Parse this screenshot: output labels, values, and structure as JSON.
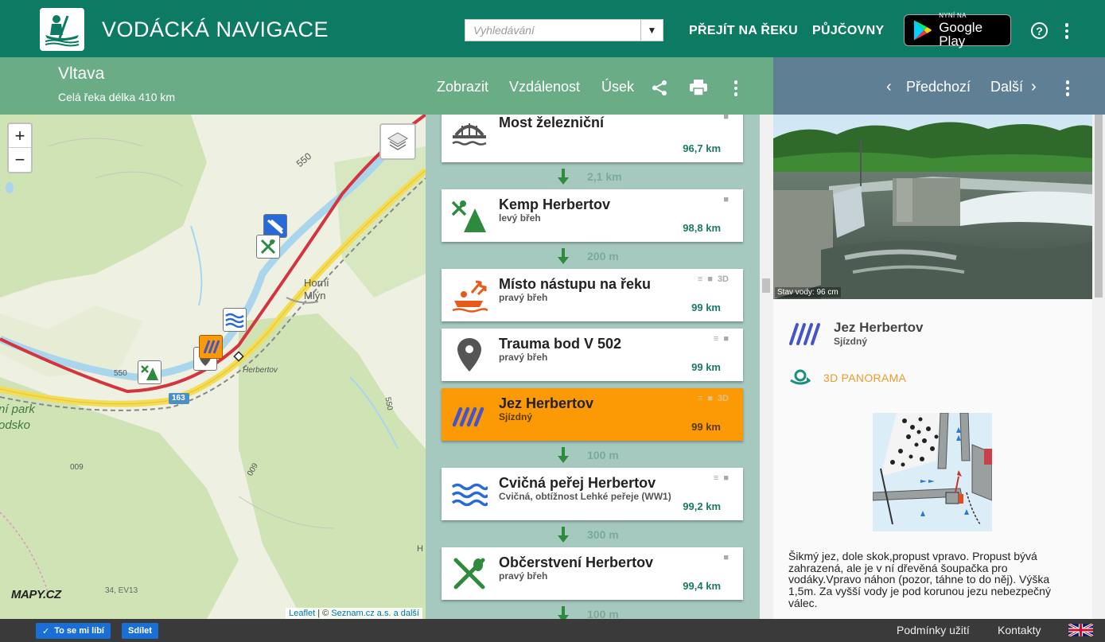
{
  "header": {
    "title": "VODÁCKÁ NAVIGACE",
    "search_placeholder": "Vyhledávání",
    "nav": [
      "PŘEJÍT NA ŘEKU",
      "PŮJČOVNY"
    ],
    "gplay_small": "NYNÍ NA",
    "gplay_big": "Google Play",
    "help": "?"
  },
  "river": {
    "name": "Vltava",
    "length_text": "Celá řeka délka 410 km",
    "actions": [
      "Zobrazit",
      "Vzdálenost",
      "Úsek"
    ]
  },
  "detail_nav": {
    "prev": "Předchozí",
    "next": "Další"
  },
  "map": {
    "labels": {
      "place1": "Horní",
      "place2": "Mlýn",
      "herbertov": "Herbertov",
      "park1": "ní park",
      "park2": "odsko",
      "h550a": "550",
      "h550b": "550",
      "h550c": "550",
      "h600a": "600",
      "h600b": "600",
      "road": "163",
      "cycle": "34, EV13",
      "h": "H"
    },
    "attribution": {
      "leaflet": "Leaflet",
      "sep": " | © ",
      "seznam": "Seznam.cz a.s. a další"
    },
    "logo": "MAPY.CZ"
  },
  "list": {
    "items": [
      {
        "title": "Most železniční",
        "sub": "",
        "km": "96,7 km",
        "icon": "bridge-icon",
        "tags": "camera"
      },
      {
        "title": "Kemp Herbertov",
        "sub": "levý břeh",
        "km": "98,8 km",
        "icon": "camp-icon",
        "tags": "camera"
      },
      {
        "title": "Místo nástupu na řeku",
        "sub": "pravý břeh",
        "km": "99 km",
        "icon": "boat-launch-icon",
        "tags": "text camera 3D"
      },
      {
        "title": "Trauma bod V 502",
        "sub": "pravý břeh",
        "km": "99 km",
        "icon": "location-pin-icon",
        "tags": "text camera"
      },
      {
        "title": "Jez Herbertov",
        "sub": "Sjízdný",
        "km": "99 km",
        "icon": "weir-icon",
        "tags": "text camera 3D"
      },
      {
        "title": "Cvičná peřej Herbertov",
        "sub": "Cvičná, obtížnost Lehké peřeje (WW1)",
        "km": "99,2 km",
        "icon": "rapids-icon",
        "tags": "text camera"
      },
      {
        "title": "Občerstvení Herbertov",
        "sub": "pravý břeh",
        "km": "99,4 km",
        "icon": "food-icon",
        "tags": "camera"
      }
    ],
    "gaps": [
      "2,1 km",
      "200 m",
      "100 m",
      "300 m",
      "100 m"
    ],
    "tag_3d": "3D"
  },
  "detail": {
    "photo_caption": "Stav vody: 96 cm",
    "title": "Jez Herbertov",
    "sub": "Sjízdný",
    "pano": "3D PANORAMA",
    "description": "Šikmý jez, dole skok,propust vpravo. Propust bývá zahrazená, ale je v ní dřevěná šoupačka pro vodáky.Vpravo náhon (pozor, táhne to do něj). Výška 1,5m. Za vyšší vody je pod korunou jezu nebezpečný válec."
  },
  "footer": {
    "like": "To se mi líbí",
    "share": "Sdílet",
    "terms": "Podmínky užití",
    "contacts": "Kontakty"
  },
  "colors": {
    "primary": "#0d7a63",
    "subbar": "#6aac86",
    "detailbar": "#5f7f95",
    "active": "#fc9a06",
    "accent": "#f09a2a"
  }
}
